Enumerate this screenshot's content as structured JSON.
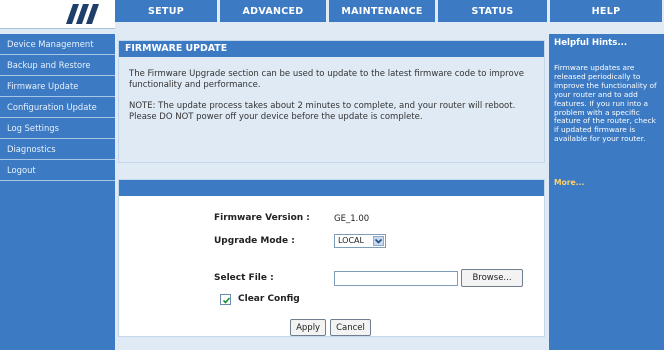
{
  "nav": {
    "tabs": [
      "SETUP",
      "ADVANCED",
      "MAINTENANCE",
      "STATUS",
      "HELP"
    ]
  },
  "sidebar": {
    "items": [
      {
        "label": "Device Management"
      },
      {
        "label": "Backup and Restore"
      },
      {
        "label": "Firmware Update"
      },
      {
        "label": "Configuration Update"
      },
      {
        "label": "Log Settings"
      },
      {
        "label": "Diagnostics"
      },
      {
        "label": "Logout"
      }
    ]
  },
  "firmware": {
    "title": "FIRMWARE UPDATE",
    "description": "The Firmware Upgrade section can be used to update to the latest firmware code to improve functionality and performance.",
    "note": "NOTE: The update process takes about 2 minutes to complete, and your router will reboot. Please DO NOT power off your device before the update is complete."
  },
  "form": {
    "version_label": "Firmware Version :",
    "version_value": "GE_1.00",
    "mode_label": "Upgrade Mode :",
    "mode_value": "LOCAL",
    "file_label": "Select File :",
    "file_value": "",
    "browse_label": "Browse...",
    "clear_config_label": "Clear Config",
    "clear_config_checked": true
  },
  "actions": {
    "apply_label": "Apply",
    "cancel_label": "Cancel"
  },
  "hints": {
    "title": "Helpful Hints...",
    "body": "Firmware updates are released periodically to improve the functionality of your router and to add features. If you run into a problem with a specific feature of the router, check if updated firmware is available for your router.",
    "more": "More..."
  }
}
